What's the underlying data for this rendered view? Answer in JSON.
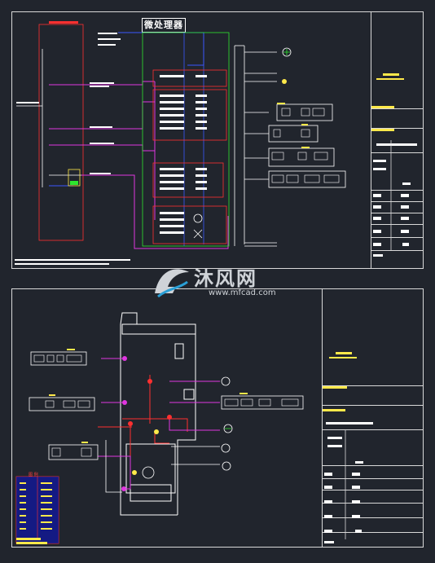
{
  "diagram": {
    "top_sheet": {
      "panel_title": "微处理器"
    },
    "watermark": {
      "brand": "沐风网",
      "url": "www.mfcad.com"
    },
    "bottom_sheet": {
      "legend_title": "图 例"
    }
  },
  "colors": {
    "background": "#21252d",
    "frame": "#d9d9d9",
    "accent_red": "#ff3030",
    "accent_magenta": "#e036e0",
    "accent_blue": "#3a58ff",
    "accent_yellow": "#ffe94a",
    "accent_green": "#2ee62e",
    "accent_cyan": "#3fe6e6"
  }
}
